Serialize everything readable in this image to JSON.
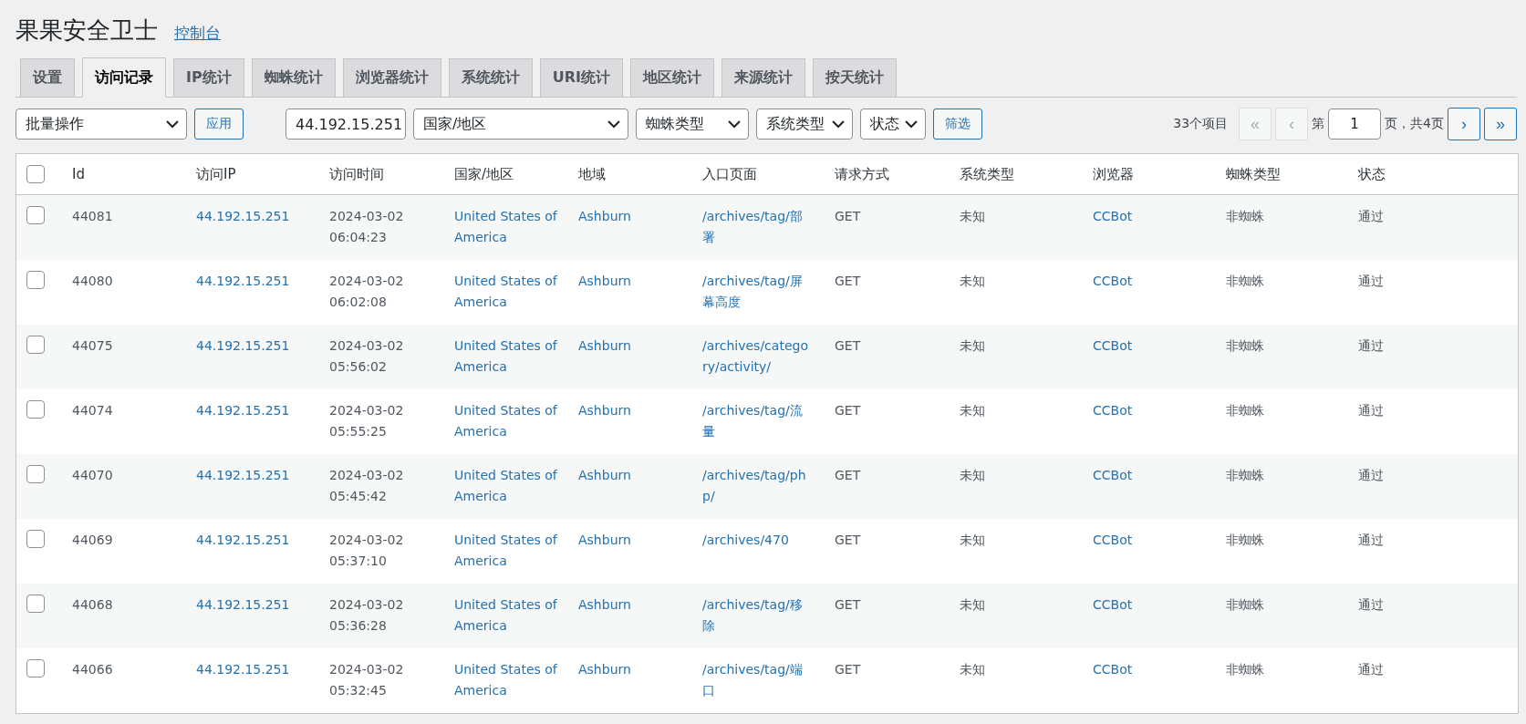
{
  "header": {
    "title": "果果安全卫士",
    "link": "控制台"
  },
  "tabs": [
    {
      "label": "设置",
      "selected": false
    },
    {
      "label": "访问记录",
      "selected": true
    },
    {
      "label": "IP统计",
      "selected": false
    },
    {
      "label": "蜘蛛统计",
      "selected": false
    },
    {
      "label": "浏览器统计",
      "selected": false
    },
    {
      "label": "系统统计",
      "selected": false
    },
    {
      "label": "URI统计",
      "selected": false
    },
    {
      "label": "地区统计",
      "selected": false
    },
    {
      "label": "来源统计",
      "selected": false
    },
    {
      "label": "按天统计",
      "selected": false
    }
  ],
  "toolbar": {
    "bulk_action": "批量操作",
    "apply": "应用",
    "ip_value": "44.192.15.251",
    "country": "国家/地区",
    "spider_type": "蜘蛛类型",
    "system_type": "系统类型",
    "status": "状态",
    "filter": "筛选"
  },
  "pagination": {
    "count": "33个项目",
    "first": {
      "label": "«",
      "disabled": true
    },
    "prev": {
      "label": "‹",
      "disabled": true
    },
    "page_prefix": "第",
    "page": "1",
    "page_suffix": "页，共4页",
    "next": {
      "label": "›",
      "disabled": false
    },
    "last": {
      "label": "»",
      "disabled": false
    }
  },
  "table": {
    "select_all_checked": false,
    "columns": [
      "Id",
      "访问IP",
      "访问时间",
      "国家/地区",
      "地域",
      "入口页面",
      "请求方式",
      "系统类型",
      "浏览器",
      "蜘蛛类型",
      "状态"
    ],
    "rows": [
      {
        "checked": false,
        "id": "44081",
        "ip": "44.192.15.251",
        "time": "2024-03-02 06:04:23",
        "country": "United States of America",
        "region": "Ashburn",
        "entry": "/archives/tag/部署",
        "method": "GET",
        "system": "未知",
        "browser": "CCBot",
        "spider": "非蜘蛛",
        "status": "通过"
      },
      {
        "checked": false,
        "id": "44080",
        "ip": "44.192.15.251",
        "time": "2024-03-02 06:02:08",
        "country": "United States of America",
        "region": "Ashburn",
        "entry": "/archives/tag/屏幕高度",
        "method": "GET",
        "system": "未知",
        "browser": "CCBot",
        "spider": "非蜘蛛",
        "status": "通过"
      },
      {
        "checked": false,
        "id": "44075",
        "ip": "44.192.15.251",
        "time": "2024-03-02 05:56:02",
        "country": "United States of America",
        "region": "Ashburn",
        "entry": "/archives/category/activity/",
        "method": "GET",
        "system": "未知",
        "browser": "CCBot",
        "spider": "非蜘蛛",
        "status": "通过"
      },
      {
        "checked": false,
        "id": "44074",
        "ip": "44.192.15.251",
        "time": "2024-03-02 05:55:25",
        "country": "United States of America",
        "region": "Ashburn",
        "entry": "/archives/tag/流量",
        "method": "GET",
        "system": "未知",
        "browser": "CCBot",
        "spider": "非蜘蛛",
        "status": "通过"
      },
      {
        "checked": false,
        "id": "44070",
        "ip": "44.192.15.251",
        "time": "2024-03-02 05:45:42",
        "country": "United States of America",
        "region": "Ashburn",
        "entry": "/archives/tag/php/",
        "method": "GET",
        "system": "未知",
        "browser": "CCBot",
        "spider": "非蜘蛛",
        "status": "通过"
      },
      {
        "checked": false,
        "id": "44069",
        "ip": "44.192.15.251",
        "time": "2024-03-02 05:37:10",
        "country": "United States of America",
        "region": "Ashburn",
        "entry": "/archives/470",
        "method": "GET",
        "system": "未知",
        "browser": "CCBot",
        "spider": "非蜘蛛",
        "status": "通过"
      },
      {
        "checked": false,
        "id": "44068",
        "ip": "44.192.15.251",
        "time": "2024-03-02 05:36:28",
        "country": "United States of America",
        "region": "Ashburn",
        "entry": "/archives/tag/移除",
        "method": "GET",
        "system": "未知",
        "browser": "CCBot",
        "spider": "非蜘蛛",
        "status": "通过"
      },
      {
        "checked": false,
        "id": "44066",
        "ip": "44.192.15.251",
        "time": "2024-03-02 05:32:45",
        "country": "United States of America",
        "region": "Ashburn",
        "entry": "/archives/tag/端口",
        "method": "GET",
        "system": "未知",
        "browser": "CCBot",
        "spider": "非蜘蛛",
        "status": "通过"
      }
    ]
  }
}
